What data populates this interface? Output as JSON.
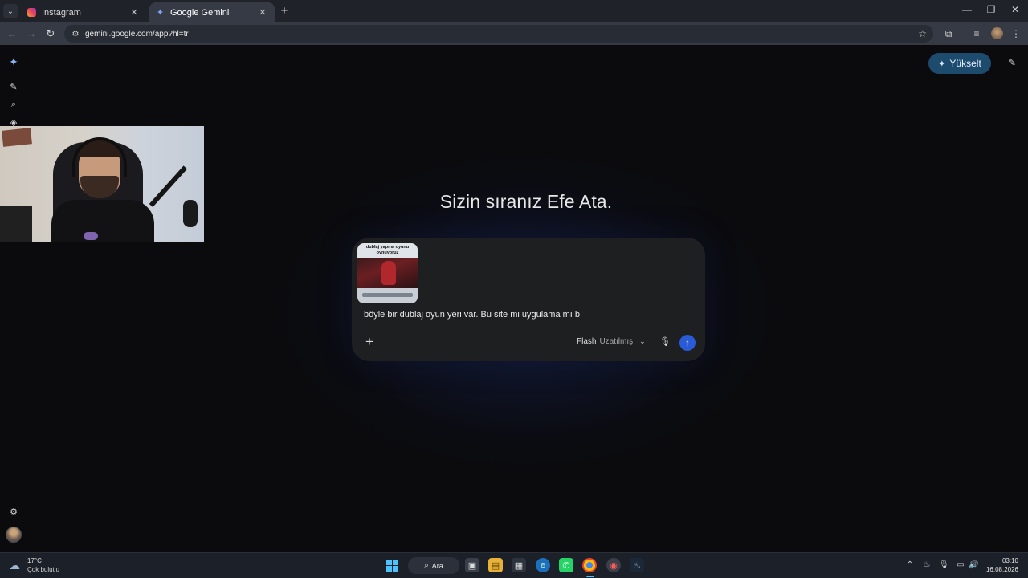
{
  "browser": {
    "tabs": [
      {
        "title": "Instagram",
        "icon": "instagram-icon",
        "active": false
      },
      {
        "title": "Google Gemini",
        "icon": "gemini-icon",
        "active": true
      }
    ],
    "url": "gemini.google.com/app?hl=tr"
  },
  "gemini": {
    "upgrade_label": "Yükselt",
    "greeting": "Sizin sıranız Efe Ata.",
    "attachment": {
      "caption": "dublaj yapma oyunu oynuyoruz"
    },
    "prompt_text": "böyle bir dublaj oyun yeri var. Bu site mi uygulama mı b",
    "model": {
      "name": "Flash",
      "variant": "Uzatılmış"
    },
    "accent_color": "#2a5bd7",
    "upgrade_color": "#1d4b6e"
  },
  "taskbar": {
    "weather": {
      "temp": "17°C",
      "desc": "Çok bulutlu"
    },
    "search_label": "Ara",
    "clock": {
      "time": "03:10",
      "date": "16.08.2026"
    }
  }
}
